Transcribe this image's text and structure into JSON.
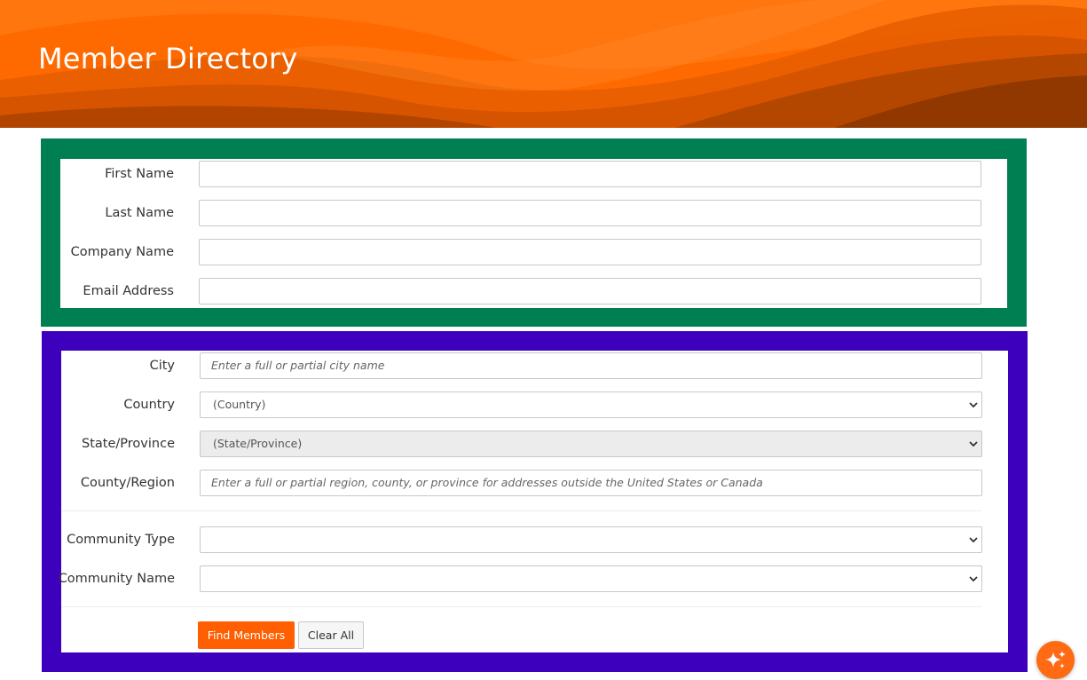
{
  "header": {
    "title": "Member Directory"
  },
  "colors": {
    "banner": "#ff6a00",
    "contact_panel": "#008052",
    "location_panel": "#3d00bd",
    "primary_button": "#ff5f00"
  },
  "contact_fields": [
    {
      "label": "First Name",
      "value": ""
    },
    {
      "label": "Last Name",
      "value": ""
    },
    {
      "label": "Company Name",
      "value": ""
    },
    {
      "label": "Email Address",
      "value": ""
    }
  ],
  "location_fields": {
    "city": {
      "label": "City",
      "placeholder": "Enter a full or partial city name"
    },
    "country": {
      "label": "Country",
      "selected": "(Country)"
    },
    "state": {
      "label": "State/Province",
      "selected": "(State/Province)"
    },
    "county": {
      "label": "County/Region",
      "placeholder": "Enter a full or partial region, county, or province for addresses outside the United States or Canada"
    }
  },
  "community_fields": {
    "type": {
      "label": "Community Type",
      "selected": ""
    },
    "name": {
      "label": "Community Name",
      "selected": ""
    }
  },
  "actions": {
    "find_label": "Find Members",
    "clear_label": "Clear All"
  },
  "icons": {
    "fab": "sparkle-icon",
    "dropdown": "chevron-down-icon"
  }
}
